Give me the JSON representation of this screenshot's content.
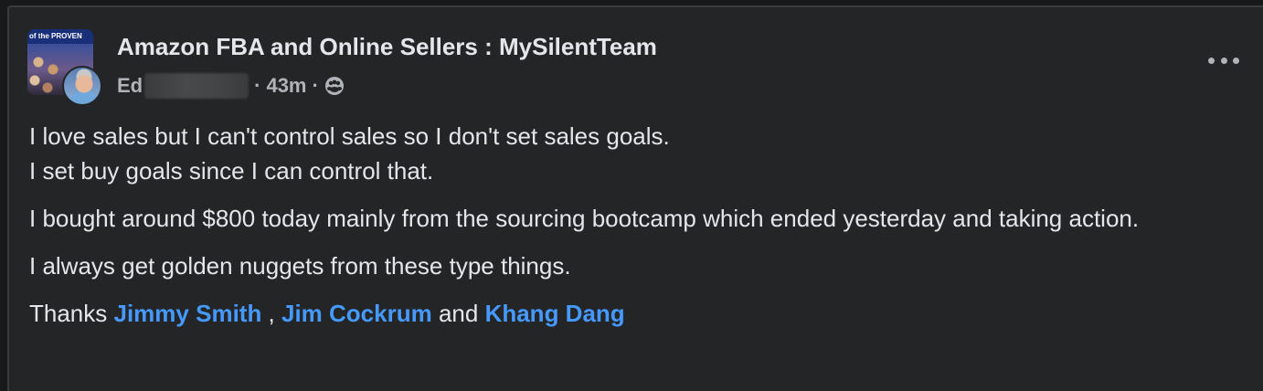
{
  "post": {
    "group_name": "Amazon FBA and Online Sellers : MySilentTeam",
    "author_visible": "Ed",
    "time": "43m",
    "separator": "·",
    "audience_icon": "group-audience-icon",
    "group_avatar_banner": "of the PROVEN",
    "paragraphs": {
      "p1_line1": "I love sales but I can't control sales so I don't set sales goals.",
      "p1_line2": "I set buy goals since I can control that.",
      "p2": "I bought around $800 today mainly from the sourcing bootcamp which ended yesterday and taking action.",
      "p3": "I always get golden nuggets from these type things.",
      "p4_prefix": "Thanks ",
      "p4_sep1": " , ",
      "p4_and": " and ",
      "mentions": [
        "Jimmy Smith",
        "Jim Cockrum",
        "Khang Dang"
      ]
    },
    "colors": {
      "background": "#242526",
      "text": "#e4e6eb",
      "secondary_text": "#b0b3b8",
      "mention": "#4599ff"
    }
  }
}
